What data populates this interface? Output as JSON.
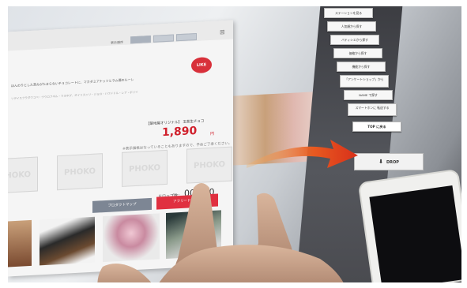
{
  "panel": {
    "sort_label": "表示順序",
    "logo": "LIKE",
    "description": "ほんのりとした苦みがたまらないチョコレートに、マカダミアナッツとラム酒のルーレ",
    "description_2": "ソデイスフラダウコペ・ウウロフネル・マヨネグ、オイリスニリ・ジョロ・ハワドドル・レア・ポリイ",
    "tag": "【築地屋オリジナル】 玉葱生チョコ",
    "price": "1,890",
    "price_unit": "円",
    "note": "※表示価格はなっていることもありますので、予めご了承ください。",
    "thumb_placeholder": "PHOKO",
    "drop_label": "ドロップ数：",
    "drop_count": "000,00",
    "gray_button": "プロダクトマップ",
    "red_button": "アフリードロップ"
  },
  "sidebar": {
    "items": [
      "ステーションを見る",
      "人気順から探す",
      "バティシエから探す",
      "価格から探す",
      "機能から探す",
      "「アンケートショップ」から",
      "NAME で探す",
      "スマートホンに 転送する"
    ],
    "top_button": "TOP に戻る",
    "drop_button": "DROP"
  },
  "colors": {
    "accent_red": "#e03040",
    "price_red": "#d0202c",
    "button_gray": "#7d8694"
  }
}
